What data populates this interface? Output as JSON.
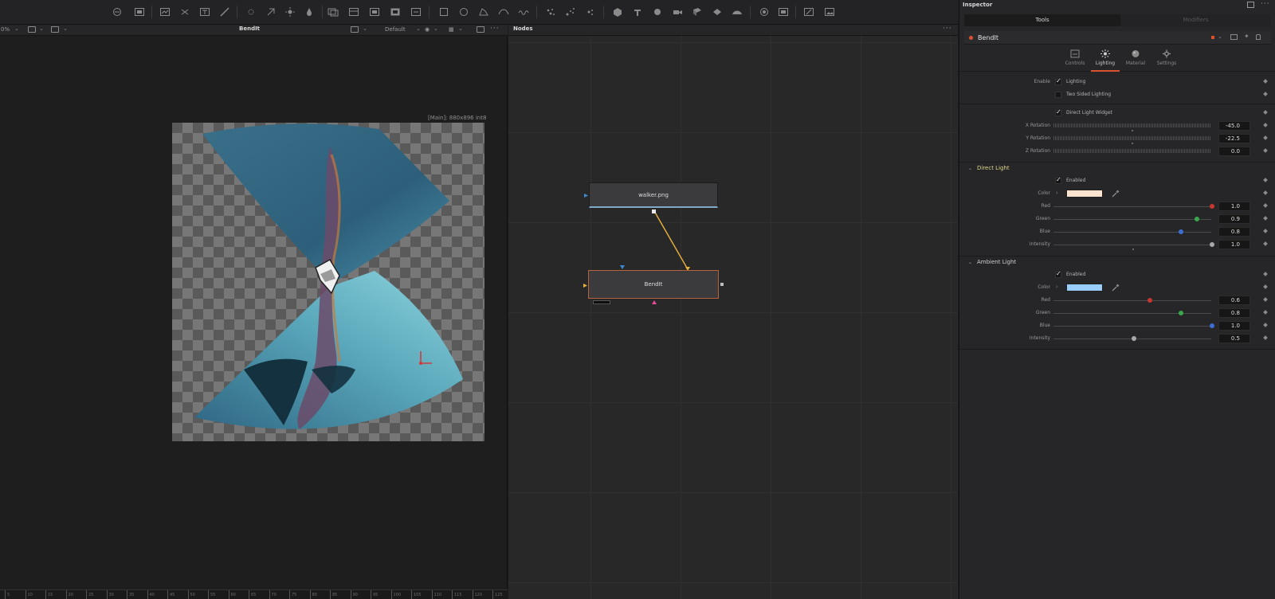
{
  "toolbar": {
    "icons": [
      "background-icon",
      "image-icon",
      "paint-icon",
      "text-icon",
      "brush-icon",
      "transform-icon",
      "blur-icon",
      "color-icon",
      "polygon-icon",
      "merge-icon",
      "loader-icon",
      "saver-icon",
      "rect-mask-icon",
      "ellipse-mask-icon",
      "bspline-icon",
      "polyline-icon",
      "particle-icon",
      "particle-emitter-icon",
      "particle-render-icon",
      "shape3d-icon",
      "text3d-icon",
      "merge3d-icon",
      "camera3d-icon",
      "renderer3d-icon",
      "light-icon",
      "spot-light-icon",
      "image-plane-icon",
      "paint-stroke-icon"
    ]
  },
  "viewer": {
    "zoom": "0%",
    "title": "BendIt",
    "lut": "Default",
    "resolution": "[Main]: 880x896 int8",
    "ruler_ticks": [
      "5",
      "10",
      "15",
      "20",
      "25",
      "30",
      "35",
      "40",
      "45",
      "50",
      "55",
      "60",
      "65",
      "70",
      "75",
      "80",
      "85",
      "90",
      "95",
      "100",
      "105",
      "110",
      "115",
      "120",
      "125",
      "130",
      "135",
      "140",
      "145"
    ]
  },
  "nodes": {
    "title": "Nodes",
    "node_walker": "walker.png",
    "node_bendit": "BendIt",
    "link_color": "#e8b23a"
  },
  "inspector": {
    "title": "Inspector",
    "tab_tools": "Tools",
    "tab_modifiers": "Modifiers",
    "tool_name": "BendIt",
    "tool_color": "#d9542e",
    "subtabs": [
      {
        "label": "Controls",
        "icon": "controls-icon"
      },
      {
        "label": "Lighting",
        "icon": "lighting-icon"
      },
      {
        "label": "Material",
        "icon": "material-icon"
      },
      {
        "label": "Settings",
        "icon": "settings-icon"
      }
    ],
    "enable_label": "Enable",
    "lighting": "Lighting",
    "two_sided": "Two Sided Lighting",
    "widget": "Direct Light Widget",
    "x_rot_label": "X Rotation",
    "x_rot": "-45.0",
    "y_rot_label": "Y Rotation",
    "y_rot": "-22.5",
    "z_rot_label": "Z Rotation",
    "z_rot": "0.0",
    "direct": {
      "title": "Direct Light",
      "enabled": "Enabled",
      "color_label": "Color",
      "color": "#ffe3d1",
      "red_label": "Red",
      "red": "1.0",
      "green_label": "Green",
      "green": "0.9",
      "blue_label": "Blue",
      "blue": "0.8",
      "intensity_label": "Intensity",
      "intensity": "1.0"
    },
    "ambient": {
      "title": "Ambient Light",
      "enabled": "Enabled",
      "color_label": "Color",
      "color": "#99ccff",
      "red_label": "Red",
      "red": "0.6",
      "green_label": "Green",
      "green": "0.8",
      "blue_label": "Blue",
      "blue": "1.0",
      "intensity_label": "Intensity",
      "intensity": "0.5"
    }
  }
}
